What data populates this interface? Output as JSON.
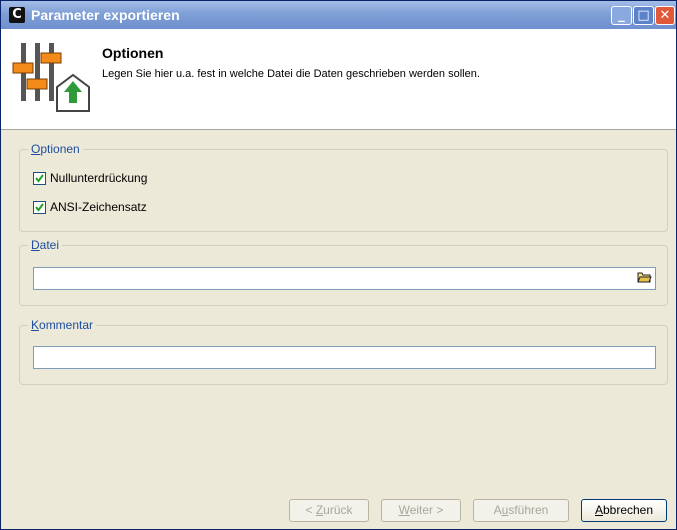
{
  "window": {
    "title": "Parameter exportieren",
    "app_icon": "C",
    "controls": {
      "minimize": "_",
      "maximize": "□",
      "close": "✕"
    }
  },
  "header": {
    "title": "Optionen",
    "subtitle": "Legen Sie hier u.a. fest in welche Datei die Daten geschrieben werden sollen.",
    "icon": "settings-sliders-icon"
  },
  "groups": {
    "options": {
      "label_access": "O",
      "label_rest": "ptionen",
      "checkboxes": [
        {
          "label": "Nullunterdrückung",
          "checked": true
        },
        {
          "label": "ANSI-Zeichensatz",
          "checked": true
        }
      ]
    },
    "file": {
      "label_access": "D",
      "label_rest": "atei",
      "value": "",
      "browse_icon": "folder-open-icon"
    },
    "comment": {
      "label_access": "K",
      "label_rest": "ommentar",
      "value": ""
    }
  },
  "buttons": {
    "back": {
      "prefix": "< ",
      "access": "Z",
      "rest": "urück",
      "enabled": false
    },
    "next": {
      "prefix": "",
      "access": "W",
      "rest": "eiter >",
      "enabled": false
    },
    "run": {
      "prefix": "A",
      "access": "u",
      "rest": "sführen",
      "enabled": false
    },
    "cancel": {
      "prefix": "",
      "access": "A",
      "rest": "bbrechen",
      "enabled": true
    }
  }
}
